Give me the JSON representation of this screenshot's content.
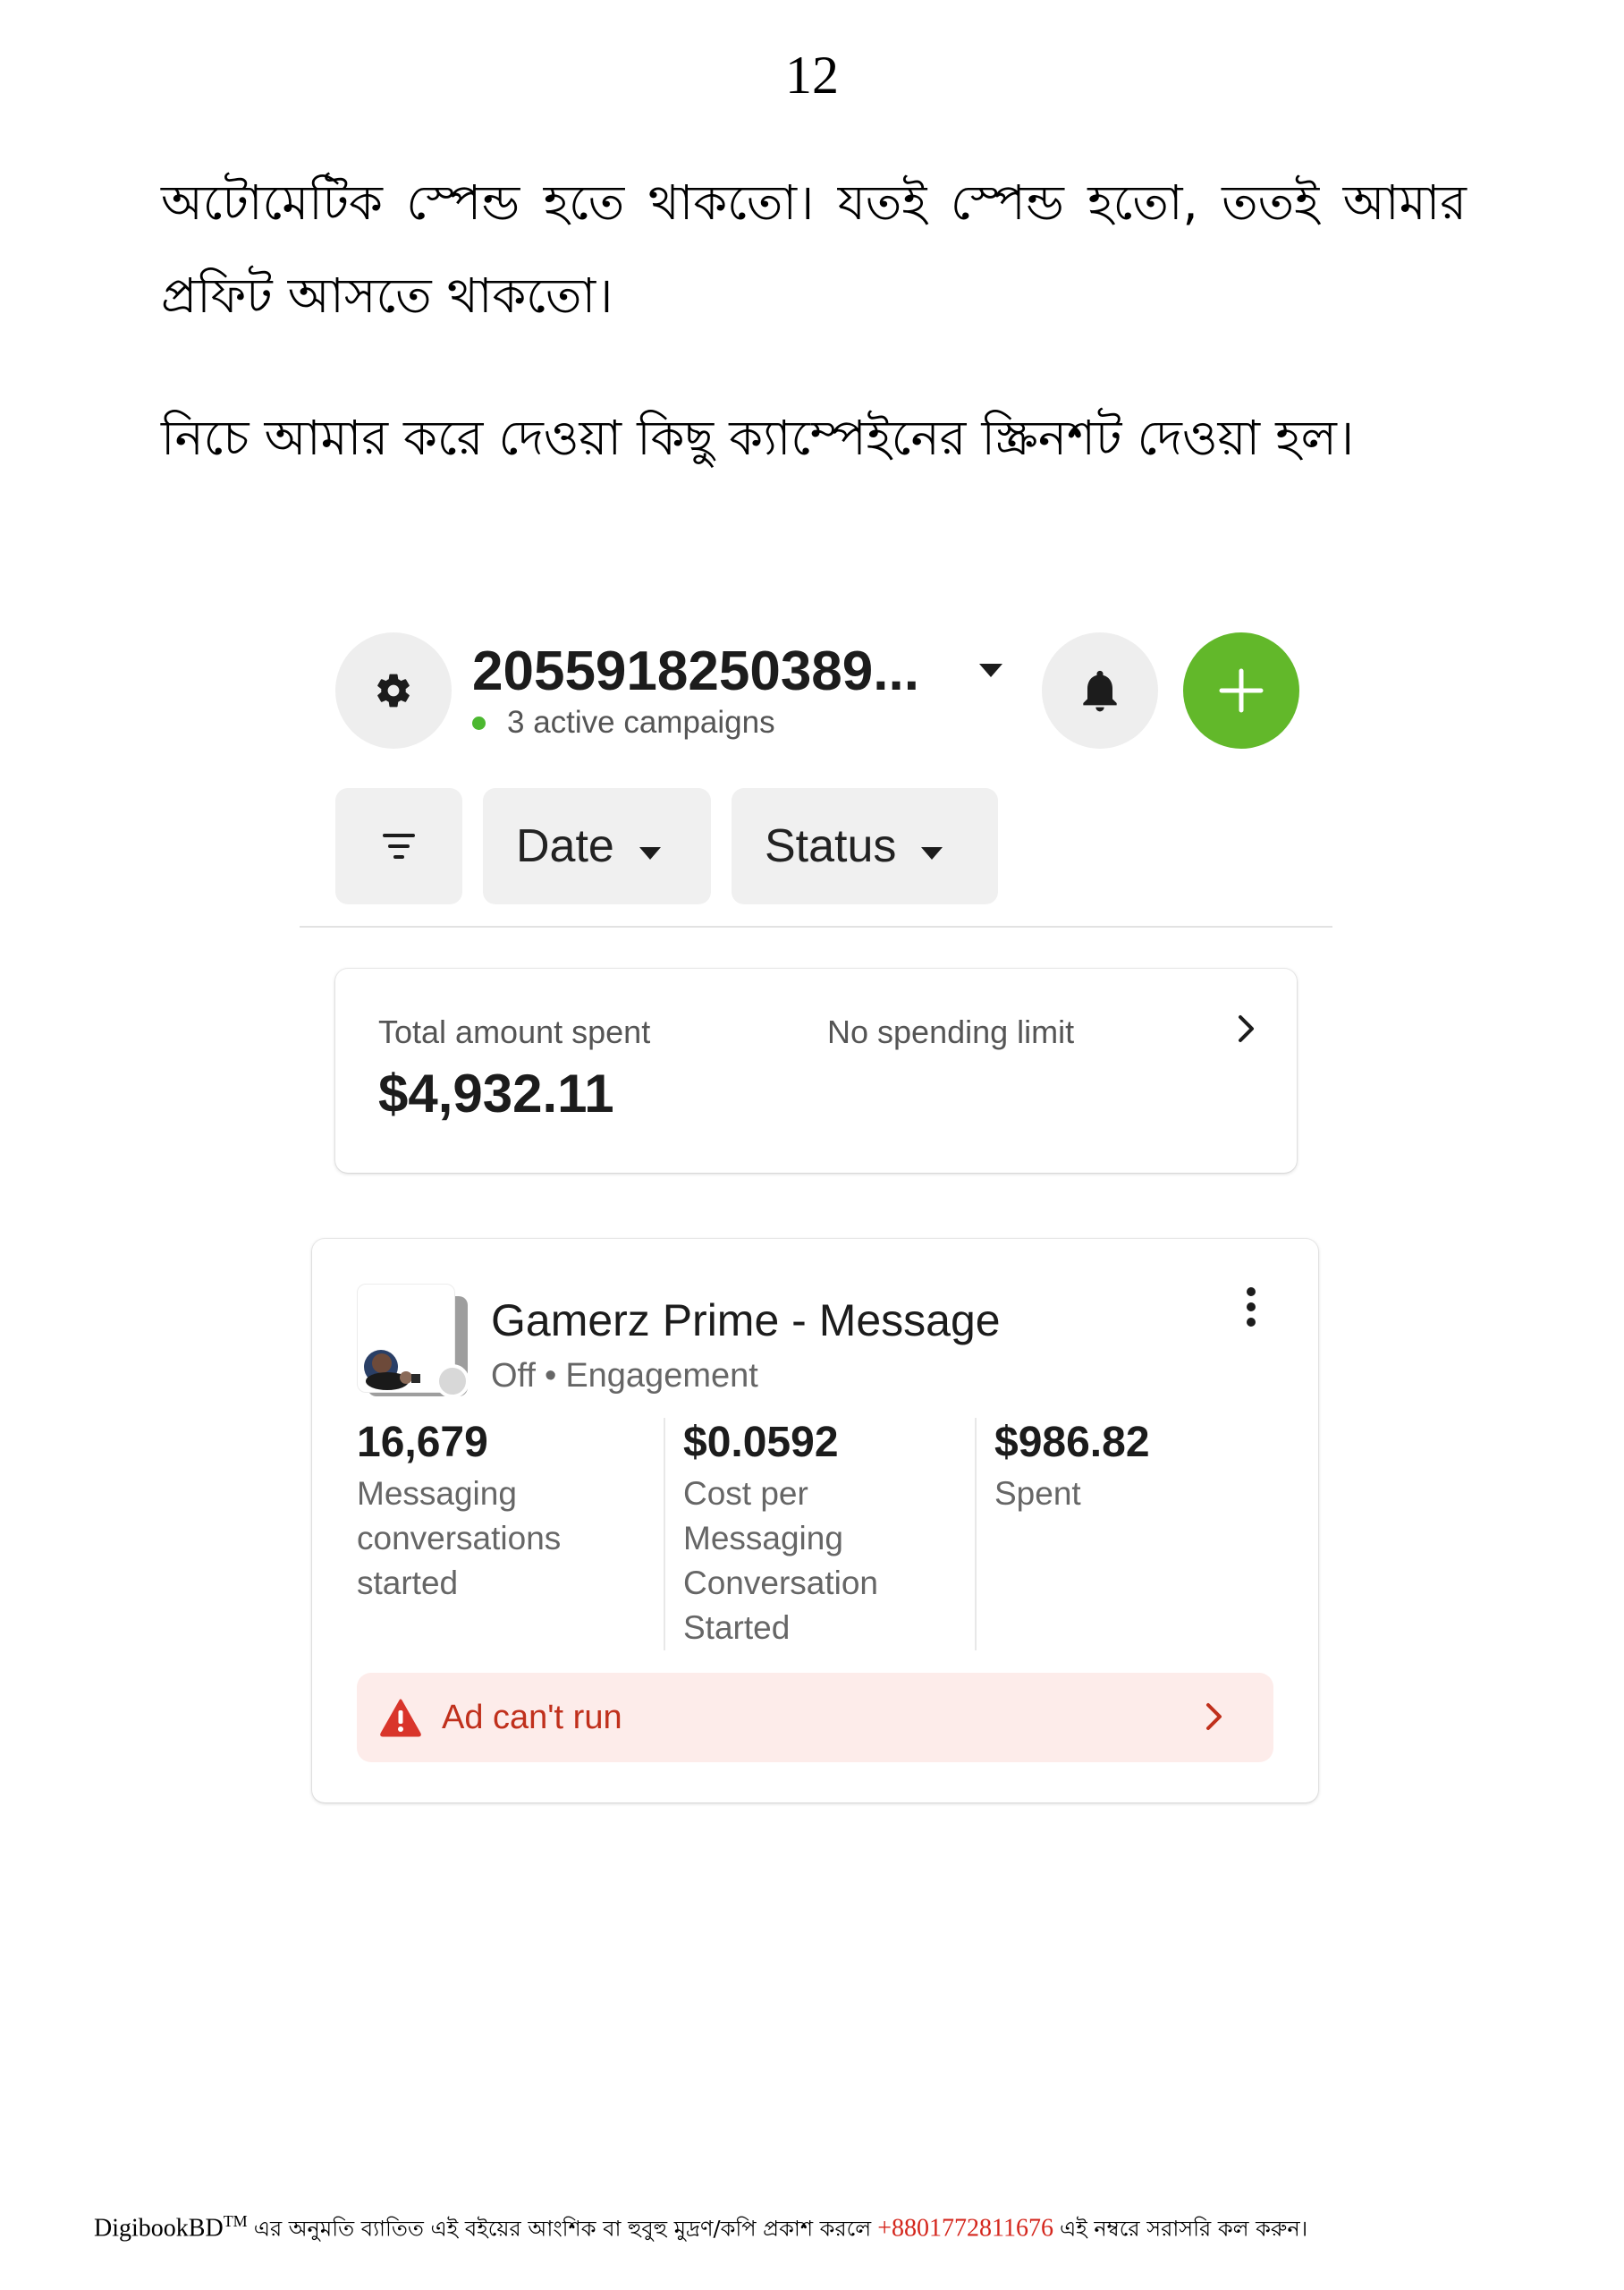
{
  "page_number": "12",
  "paragraphs": {
    "p1": "অটোমেটিক স্পেন্ড হতে থাকতো। যতই স্পেন্ড হতো, ততই আমার প্রফিট আসতে থাকতো।",
    "p2": "নিচে আমার করে দেওয়া কিছু ক্যাম্পেইনের স্ক্রিনশট দেওয়া হল।"
  },
  "screenshot": {
    "header": {
      "account_id": "2055918250389...",
      "active_campaigns": "3 active campaigns",
      "icons": {
        "settings": "gear-icon",
        "account_dropdown": "caret-down-icon",
        "notifications": "bell-icon",
        "create": "plus-icon"
      }
    },
    "filters": {
      "filter_icon": "filter-icon",
      "date_label": "Date",
      "status_label": "Status"
    },
    "spending": {
      "total_label": "Total amount spent",
      "total_value": "$4,932.11",
      "limit_label": "No spending limit"
    },
    "campaign": {
      "name": "Gamerz Prime - Message",
      "status": "Off",
      "separator": "•",
      "objective": "Engagement",
      "metrics": [
        {
          "value": "16,679",
          "label": "Messaging conversations started"
        },
        {
          "value": "$0.0592",
          "label": "Cost per Messaging Conversation Started"
        },
        {
          "value": "$986.82",
          "label": "Spent"
        }
      ],
      "alert": "Ad can't run"
    },
    "colors": {
      "accent_green": "#62b82a",
      "alert_bg": "#fdecea",
      "alert_text": "#c0301c"
    }
  },
  "footer": {
    "brand": "DigibookBD",
    "tm": "TM",
    "text_before_phone": "এর অনুমতি ব্যাতিত এই বইয়ের আংশিক বা হুবুহু মুদ্রণ/কপি প্রকাশ করলে",
    "phone": "+8801772811676",
    "text_after_phone": "এই নম্বরে সরাসরি কল করুন।"
  }
}
